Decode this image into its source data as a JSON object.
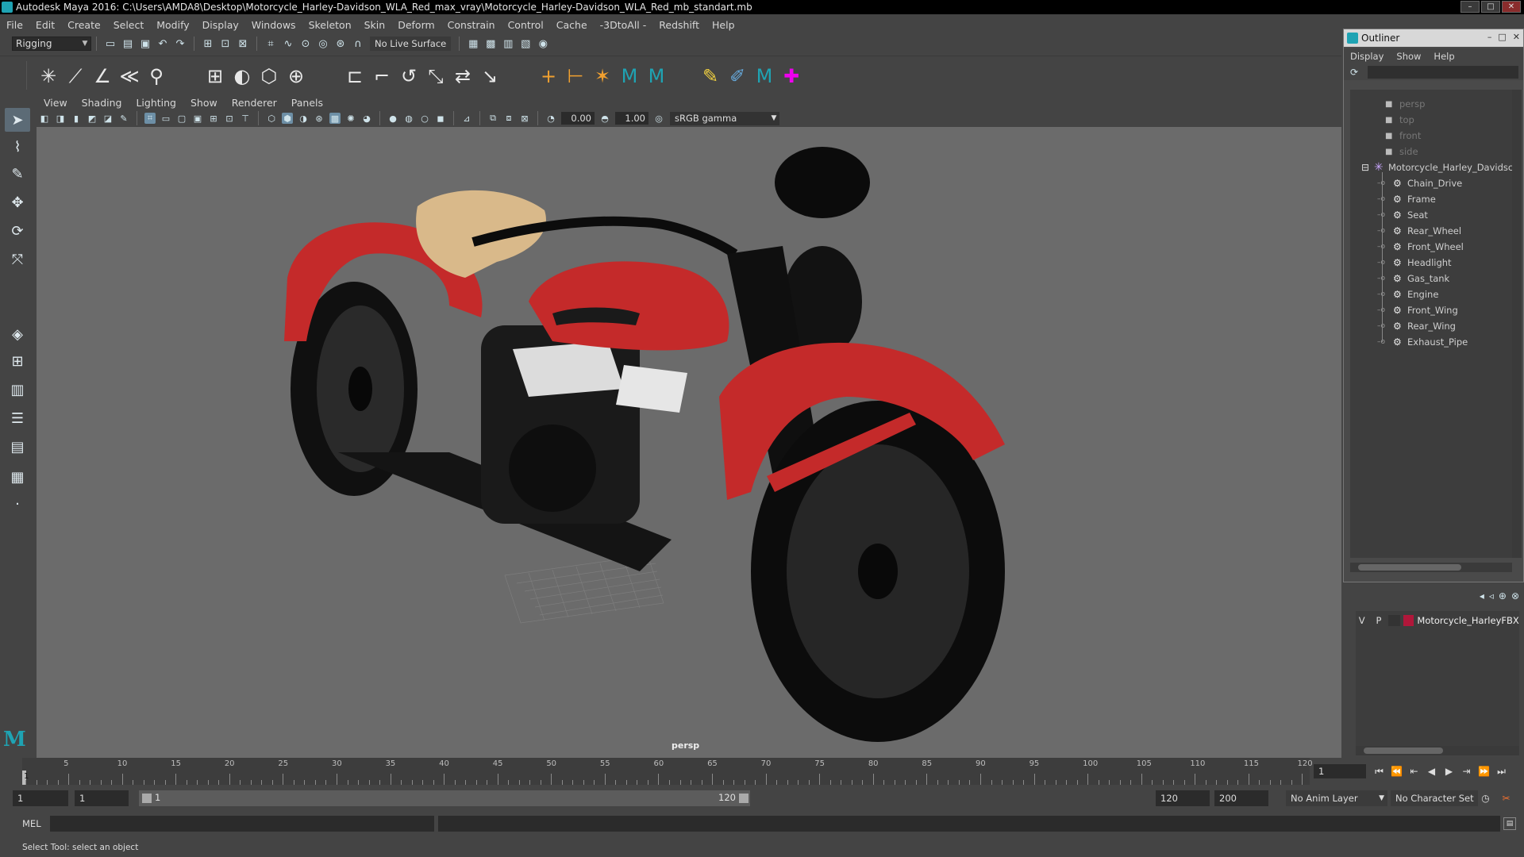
{
  "window": {
    "title": "Autodesk Maya 2016: C:\\Users\\AMDA8\\Desktop\\Motorcycle_Harley-Davidson_WLA_Red_max_vray\\Motorcycle_Harley-Davidson_WLA_Red_mb_standart.mb"
  },
  "menu": [
    "File",
    "Edit",
    "Create",
    "Select",
    "Modify",
    "Display",
    "Windows",
    "Skeleton",
    "Skin",
    "Deform",
    "Constrain",
    "Control",
    "Cache",
    "-3DtoAll -",
    "Redshift",
    "Help"
  ],
  "statusline": {
    "mode": "Rigging",
    "live_surface": "No Live Surface"
  },
  "panel": {
    "menu": [
      "View",
      "Shading",
      "Lighting",
      "Show",
      "Renderer",
      "Panels"
    ],
    "exposure": "0.00",
    "gamma": "1.00",
    "color_space": "sRGB gamma",
    "camera": "persp"
  },
  "timeline": {
    "ticks": [
      "5",
      "10",
      "15",
      "20",
      "25",
      "30",
      "35",
      "40",
      "45",
      "50",
      "55",
      "60",
      "65",
      "70",
      "75",
      "80",
      "85",
      "90",
      "95",
      "100",
      "105",
      "110",
      "115",
      "120"
    ],
    "current_frame_label": "1",
    "current_frame": "1"
  },
  "range": {
    "start": "1",
    "playback_start": "1",
    "range_start_label": "1",
    "range_end_label": "120",
    "playback_end": "120",
    "end": "200",
    "anim_layer": "No Anim Layer",
    "character_set": "No Character Set"
  },
  "command": {
    "label": "MEL"
  },
  "help_line": "Select Tool: select an object",
  "outliner": {
    "title": "Outliner",
    "menu": [
      "Display",
      "Show",
      "Help"
    ],
    "cameras": [
      "persp",
      "top",
      "front",
      "side"
    ],
    "group": "Motorcycle_Harley_Davidsc",
    "children": [
      "Chain_Drive",
      "Frame",
      "Seat",
      "Rear_Wheel",
      "Front_Wheel",
      "Headlight",
      "Gas_tank",
      "Engine",
      "Front_Wing",
      "Rear_Wing",
      "Exhaust_Pipe"
    ]
  },
  "layers": {
    "rows": [
      {
        "visible": "V",
        "playback": "P",
        "color": "#b0173a",
        "name": "Motorcycle_HarleyFBXASC"
      }
    ]
  },
  "colors": {
    "maya_accent": "#1fa3b3",
    "bike_red": "#c42a2a",
    "seat_tan": "#d9b98a"
  }
}
